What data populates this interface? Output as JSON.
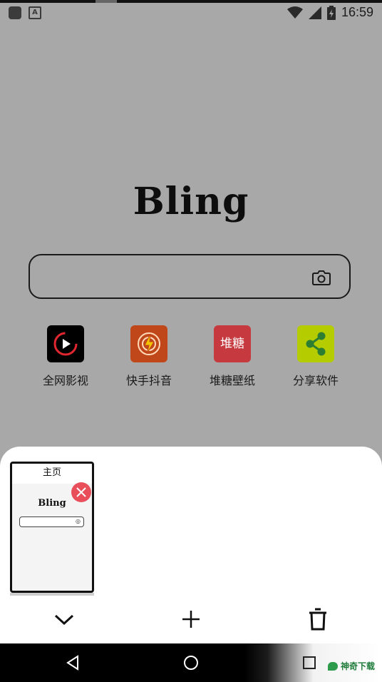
{
  "status_bar": {
    "time": "16:59",
    "left_icons": [
      "app-icon",
      "text-a-icon"
    ],
    "right_icons": [
      "wifi-icon",
      "signal-icon",
      "battery-icon"
    ],
    "text_a_glyph": "A"
  },
  "brand": {
    "title": "Bling"
  },
  "search": {
    "value": "",
    "placeholder": "",
    "camera_icon": "camera-icon"
  },
  "shortcuts": [
    {
      "label": "全网影视",
      "icon": "play-icon",
      "color": "#000000"
    },
    {
      "label": "快手抖音",
      "icon": "lightning-icon",
      "color": "#c0471a"
    },
    {
      "label": "堆糖壁纸",
      "icon_text": "堆糖",
      "color": "#c63a3f"
    },
    {
      "label": "分享软件",
      "icon": "share-icon",
      "color": "#b5cc00"
    }
  ],
  "tab_switcher": {
    "tabs": [
      {
        "title": "主页",
        "preview_brand": "Bling",
        "close_icon": "close-icon"
      }
    ],
    "actions": [
      "chevron-down-icon",
      "plus-icon",
      "trash-icon"
    ]
  },
  "nav_bar": {
    "buttons": [
      "back-icon",
      "home-icon",
      "recents-icon"
    ]
  },
  "watermark": {
    "text": "神奇下载"
  },
  "colors": {
    "overlay": "#a8a8a8",
    "sheet": "#ffffff",
    "close": "#e84f5b"
  }
}
